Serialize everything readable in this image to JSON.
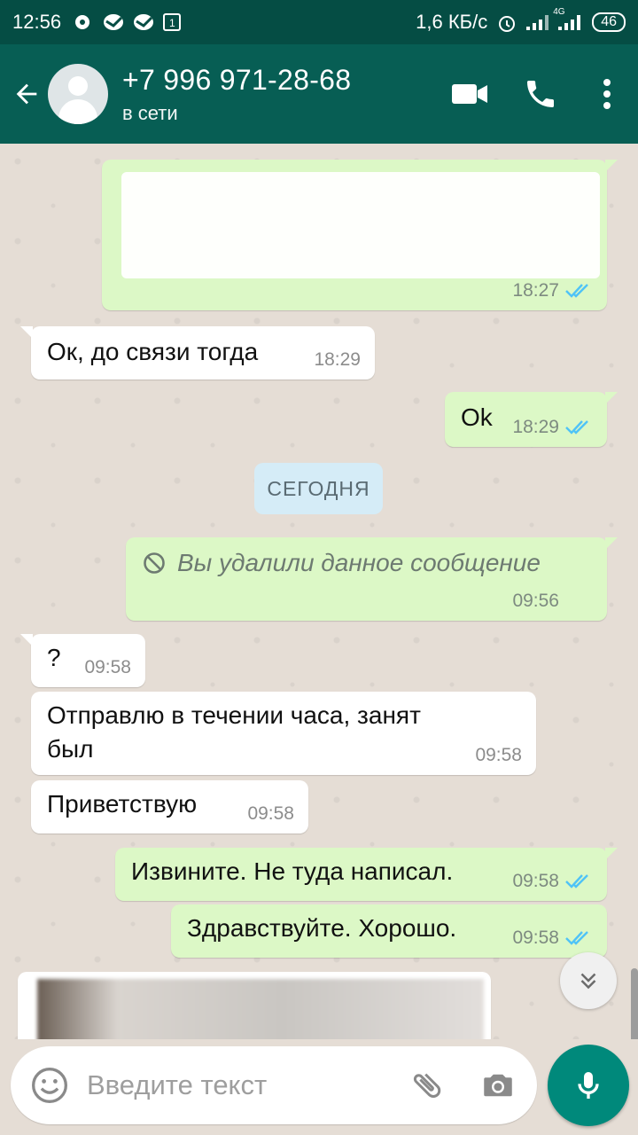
{
  "status_bar": {
    "time": "12:56",
    "network_speed": "1,6 КБ/с",
    "battery": "46",
    "network_type": "4G"
  },
  "header": {
    "contact_name": "+7 996 971-28-68",
    "contact_status": "в сети",
    "icons": [
      "back-arrow-icon",
      "avatar",
      "video-call-icon",
      "phone-icon",
      "more-vert-icon"
    ]
  },
  "messages": [
    {
      "direction": "out",
      "text": "",
      "time": "18:27",
      "ticks": "read",
      "redacted": true
    },
    {
      "direction": "in",
      "text": "Ок, до связи тогда",
      "time": "18:29"
    },
    {
      "direction": "out",
      "text": "Ok",
      "time": "18:29",
      "ticks": "read"
    },
    {
      "direction": "out",
      "text": "Вы удалили данное сообщение",
      "time": "09:56",
      "deleted": true
    },
    {
      "direction": "in",
      "text": "?",
      "time": "09:58"
    },
    {
      "direction": "in",
      "text": "Отправлю в течении часа, занят был",
      "line1": "Отправлю в течении часа, занят",
      "line2": "был",
      "time": "09:58"
    },
    {
      "direction": "in",
      "text": "Приветствую",
      "time": "09:58"
    },
    {
      "direction": "out",
      "text": "Извините. Не туда написал.",
      "time": "09:58",
      "ticks": "read"
    },
    {
      "direction": "out",
      "text": "Здравствуйте. Хорошо.",
      "time": "09:58",
      "ticks": "read"
    }
  ],
  "date_separator": "СЕГОДНЯ",
  "input": {
    "placeholder": "Введите текст"
  },
  "colors": {
    "header": "#075e54",
    "status_bar": "#054d44",
    "outgoing_bubble": "#dcf8c6",
    "incoming_bubble": "#ffffff",
    "read_ticks": "#4fc3f7",
    "mic_button": "#00897b"
  }
}
